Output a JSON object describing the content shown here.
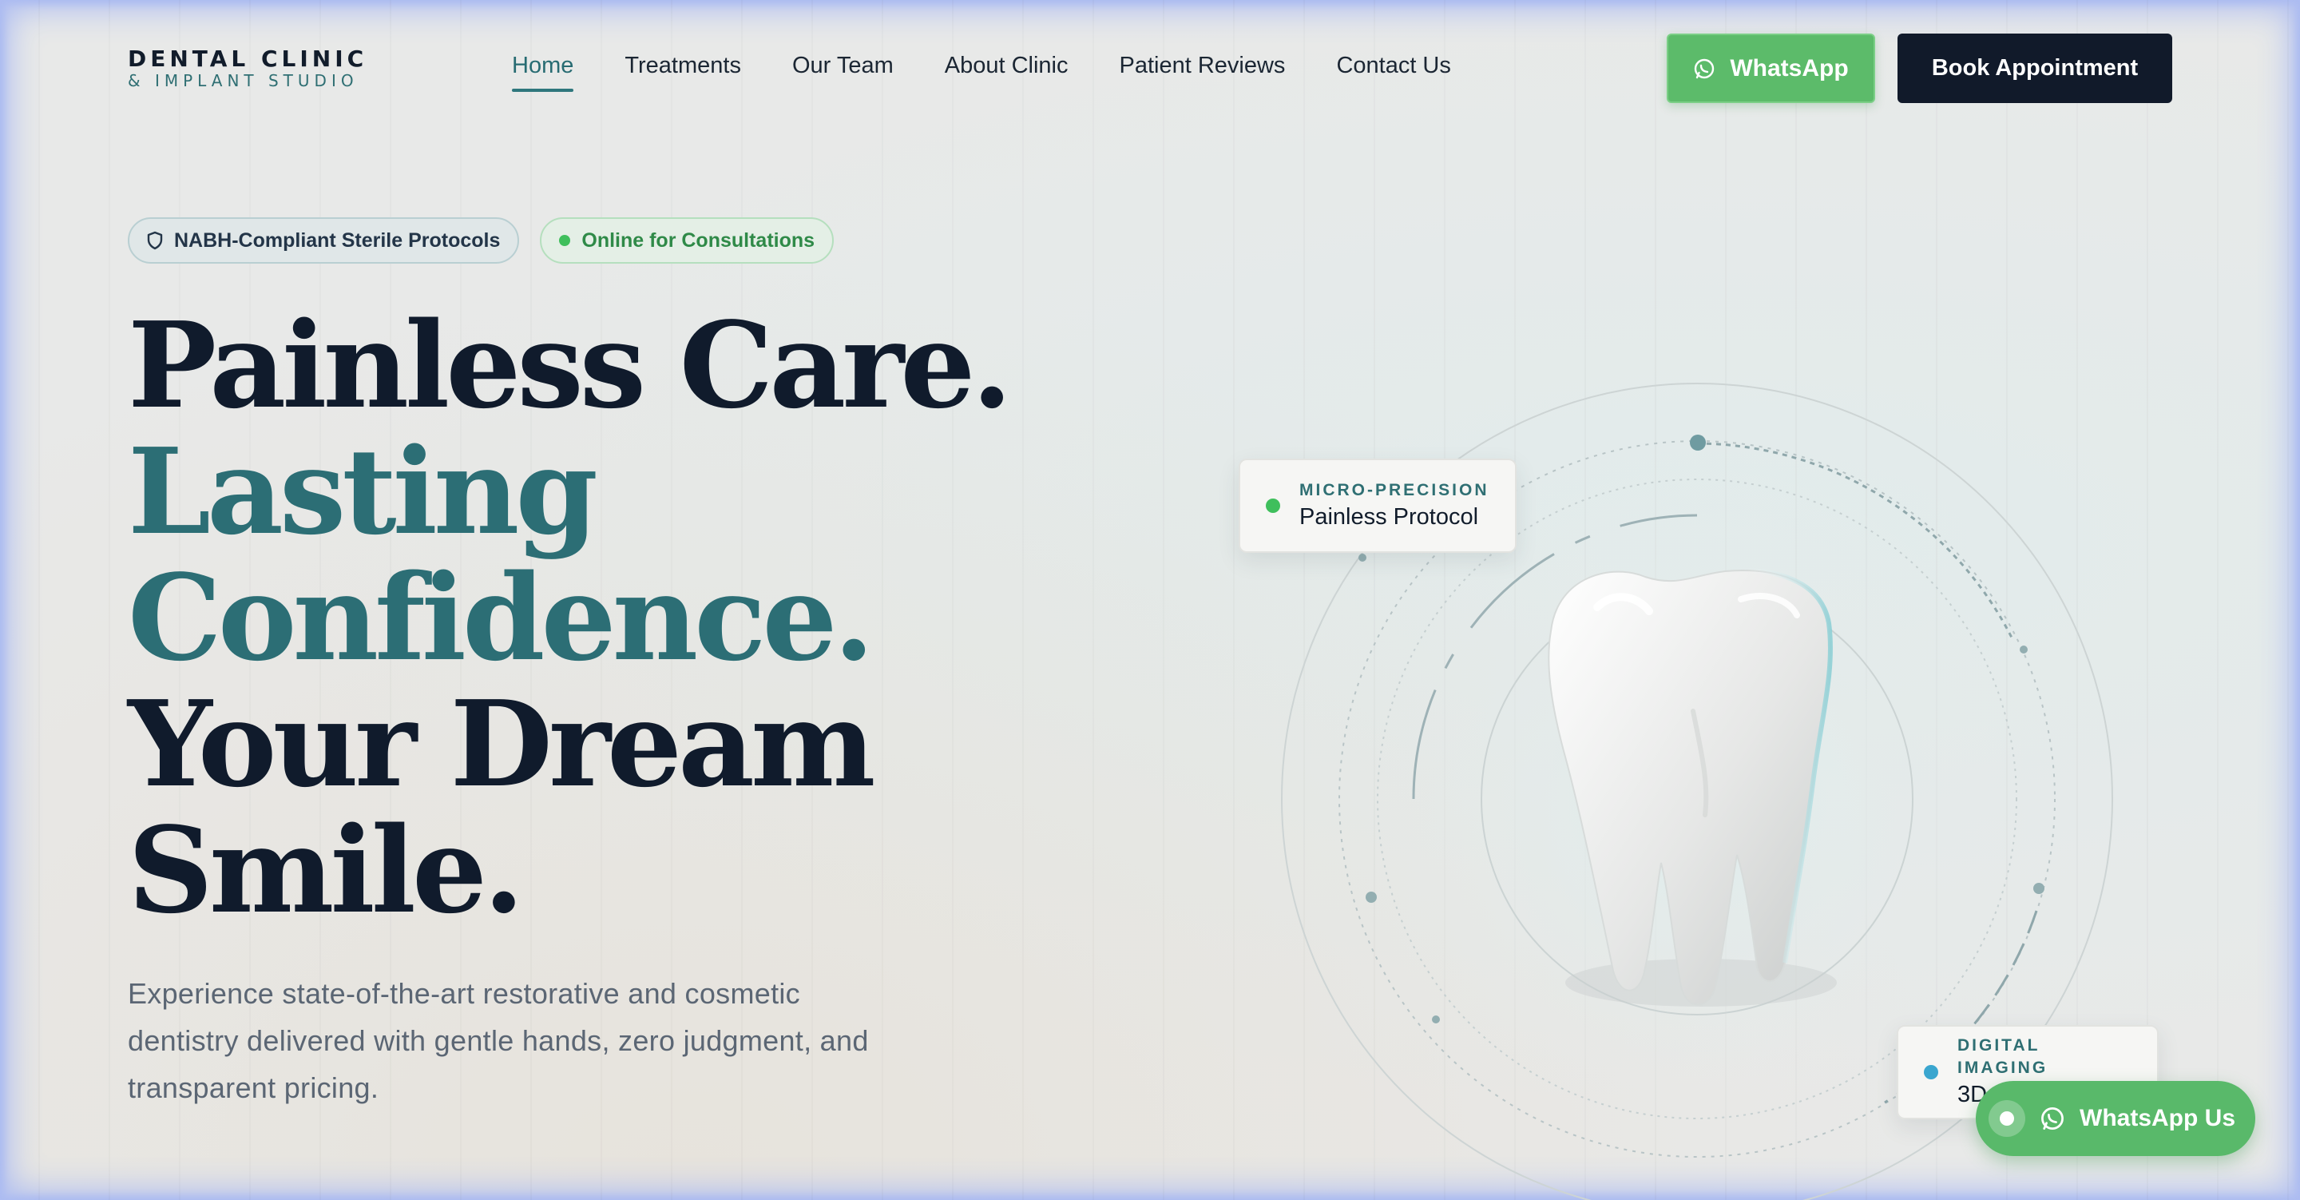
{
  "brand": {
    "name": "DENTAL CLINIC",
    "tagline": "& IMPLANT STUDIO"
  },
  "nav": {
    "items": [
      {
        "label": "Home",
        "active": true
      },
      {
        "label": "Treatments",
        "active": false
      },
      {
        "label": "Our Team",
        "active": false
      },
      {
        "label": "About Clinic",
        "active": false
      },
      {
        "label": "Patient Reviews",
        "active": false
      },
      {
        "label": "Contact Us",
        "active": false
      }
    ]
  },
  "header_actions": {
    "whatsapp_label": "WhatsApp",
    "whatsapp_icon": "whatsapp-icon",
    "book_label": "Book Appointment"
  },
  "badges": {
    "nabh": {
      "label": "NABH-Compliant Sterile Protocols",
      "icon": "shield-icon"
    },
    "online": {
      "label": "Online for Consultations",
      "status_color": "#3fbf5c"
    }
  },
  "hero": {
    "line1": "Painless Care.",
    "line2": "Lasting",
    "line3": "Confidence.",
    "line4": "Your Dream",
    "line5": "Smile.",
    "description": "Experience state-of-the-art restorative and cosmetic dentistry delivered with gentle hands, zero judgment, and transparent pricing."
  },
  "illustration": {
    "icon": "tooth-icon",
    "card_top": {
      "label": "MICRO-PRECISION",
      "value": "Painless Protocol",
      "dot_color": "#3fbf5c"
    },
    "card_bottom": {
      "label": "DIGITAL IMAGING",
      "value": "3D CBCT S",
      "dot_color": "#3aa6cf"
    }
  },
  "floating_whatsapp": {
    "label": "WhatsApp Us",
    "icon": "whatsapp-icon"
  },
  "colors": {
    "teal": "#2c6e75",
    "navy": "#111a2a",
    "whatsapp_green": "#5cbb6a",
    "frame_glow": "#aebdf2"
  }
}
